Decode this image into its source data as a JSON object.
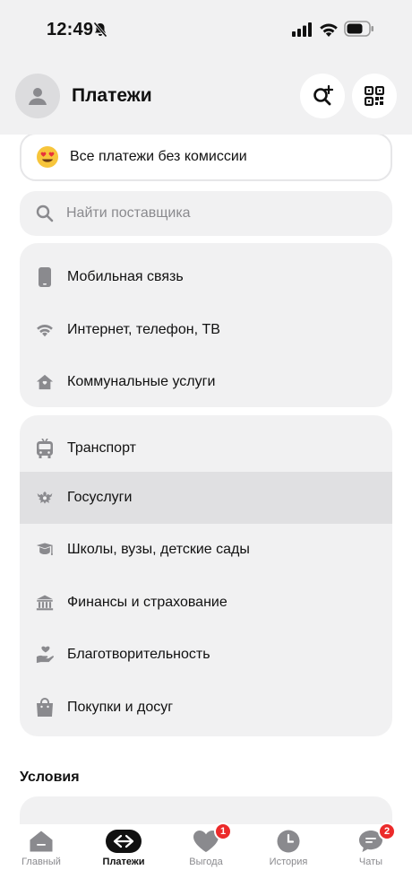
{
  "status_bar": {
    "time": "12:49"
  },
  "header": {
    "title": "Платежи"
  },
  "promo": {
    "text": "Все платежи без комиссии",
    "icon": "heart-eyes-emoji"
  },
  "search": {
    "placeholder": "Найти поставщика"
  },
  "groups": [
    {
      "items": [
        {
          "label": "Мобильная связь",
          "icon": "phone-icon"
        },
        {
          "label": "Интернет, телефон, ТВ",
          "icon": "wifi-icon"
        },
        {
          "label": "Коммунальные услуги",
          "icon": "home-icon"
        }
      ]
    },
    {
      "items": [
        {
          "label": "Транспорт",
          "icon": "bus-icon"
        },
        {
          "label": "Госуслуги",
          "icon": "emblem-icon",
          "selected": true
        },
        {
          "label": "Школы, вузы, детские сады",
          "icon": "graduation-cap-icon"
        },
        {
          "label": "Финансы и страхование",
          "icon": "bank-icon"
        },
        {
          "label": "Благотворительность",
          "icon": "charity-icon"
        },
        {
          "label": "Покупки и досуг",
          "icon": "shopping-bag-icon"
        }
      ]
    }
  ],
  "conditions": {
    "title": "Условия"
  },
  "tabbar": {
    "tabs": [
      {
        "label": "Главный",
        "icon": "home-icon"
      },
      {
        "label": "Платежи",
        "icon": "transfer-arrows-icon",
        "active": true
      },
      {
        "label": "Выгода",
        "icon": "heart-icon",
        "badge": "1"
      },
      {
        "label": "История",
        "icon": "clock-icon"
      },
      {
        "label": "Чаты",
        "icon": "chat-icon",
        "badge": "2"
      }
    ]
  },
  "colors": {
    "accent": "#111111",
    "badge": "#ec2a2a",
    "icon": "#8a8a8e",
    "surface": "#f1f1f2"
  }
}
